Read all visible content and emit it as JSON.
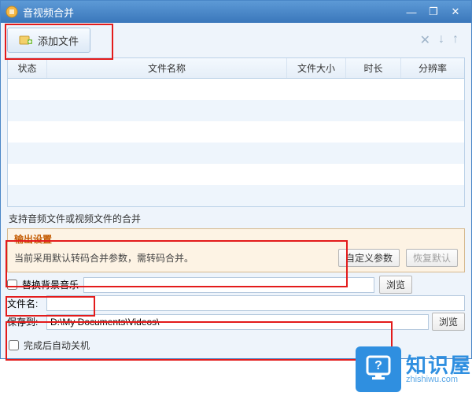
{
  "title": "音视频合并",
  "toolbar": {
    "add_label": "添加文件",
    "clear_icon": "✕",
    "down_icon": "↓",
    "up_icon": "↑"
  },
  "columns": {
    "status": "状态",
    "name": "文件名称",
    "size": "文件大小",
    "duration": "时长",
    "resolution": "分辨率"
  },
  "rows": [
    {},
    {},
    {},
    {},
    {},
    {}
  ],
  "support_note": "支持音频文件或视频文件的合并",
  "output": {
    "title": "输出设置",
    "note": "当前采用默认转码合并参数，需转码合并。",
    "custom_btn": "自定义参数",
    "restore_btn": "恢复默认"
  },
  "bgm": {
    "label": "替换背景音乐",
    "path": "",
    "browse": "浏览"
  },
  "file": {
    "name_label": "文件名:",
    "name_value": "",
    "save_label": "保存到:",
    "save_value": "D:\\My Documents\\Videos\\",
    "browse": "浏览"
  },
  "auto_off": "完成后自动关机",
  "watermark": {
    "cn": "知识屋",
    "en": "zhishiwu.com"
  }
}
